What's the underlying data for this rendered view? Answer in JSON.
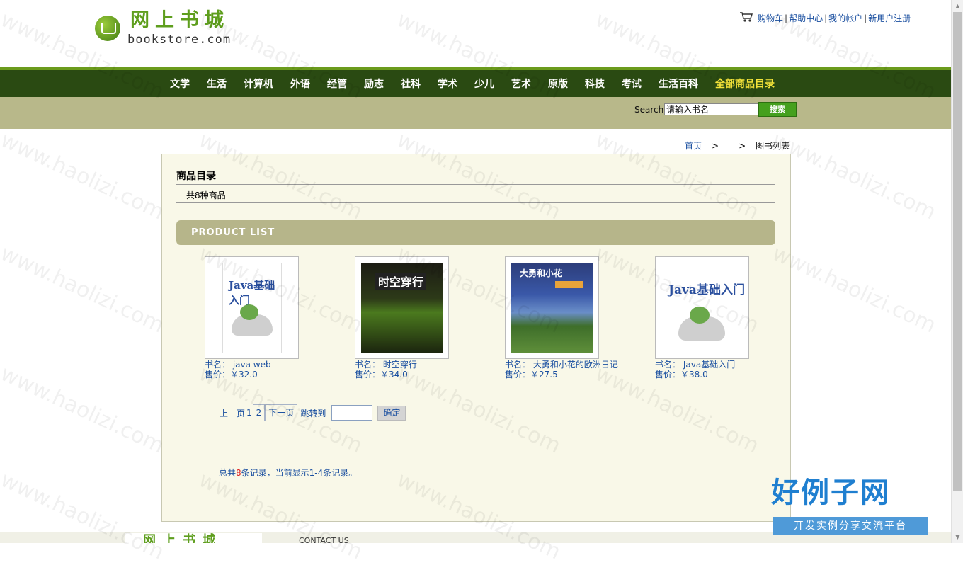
{
  "logo": {
    "cn": "网上书城",
    "en": "bookstore.com"
  },
  "toplinks": [
    "购物车",
    "帮助中心",
    "我的帐户",
    "新用户注册"
  ],
  "nav": {
    "items": [
      "文学",
      "生活",
      "计算机",
      "外语",
      "经管",
      "励志",
      "社科",
      "学术",
      "少儿",
      "艺术",
      "原版",
      "科技",
      "考试",
      "生活百科"
    ],
    "highlight": "全部商品目录"
  },
  "search": {
    "label": "Search",
    "value": "请输入书名",
    "button": "搜索"
  },
  "breadcrumb": {
    "home": "首页",
    "sep": ">",
    "current": "图书列表"
  },
  "catalog": {
    "title": "商品目录",
    "count": "共8种商品",
    "banner": "PRODUCT LIST"
  },
  "books": [
    {
      "name_label": "书名：",
      "name": "java web",
      "price_label": "售价：",
      "price": "￥32.0",
      "cover_title": "Java基础入门"
    },
    {
      "name_label": "书名：",
      "name": "时空穿行",
      "price_label": "售价：",
      "price": "￥34.0",
      "cover_title": "时空穿行"
    },
    {
      "name_label": "书名：",
      "name": "大勇和小花的欧洲日记",
      "price_label": "售价：",
      "price": "￥27.5",
      "cover_title": "大勇和小花"
    },
    {
      "name_label": "书名：",
      "name": "Java基础入门",
      "price_label": "售价：",
      "price": "￥38.0",
      "cover_title": "Java基础入门"
    }
  ],
  "pager": {
    "prev": "上一页",
    "page1": "1",
    "page2": "2",
    "next": "下一页",
    "jump": "跳转到",
    "confirm": "确定"
  },
  "summary": {
    "prefix": "总共",
    "total": "8",
    "suffix": "条记录，当前显示1-4条记录。"
  },
  "footer": {
    "logo_cn": "网上书城",
    "contact": "CONTACT US"
  },
  "watermark": {
    "text": "www.haolizi.com",
    "badge_big": "好例子网",
    "badge_small": "开发实例分享交流平台"
  }
}
